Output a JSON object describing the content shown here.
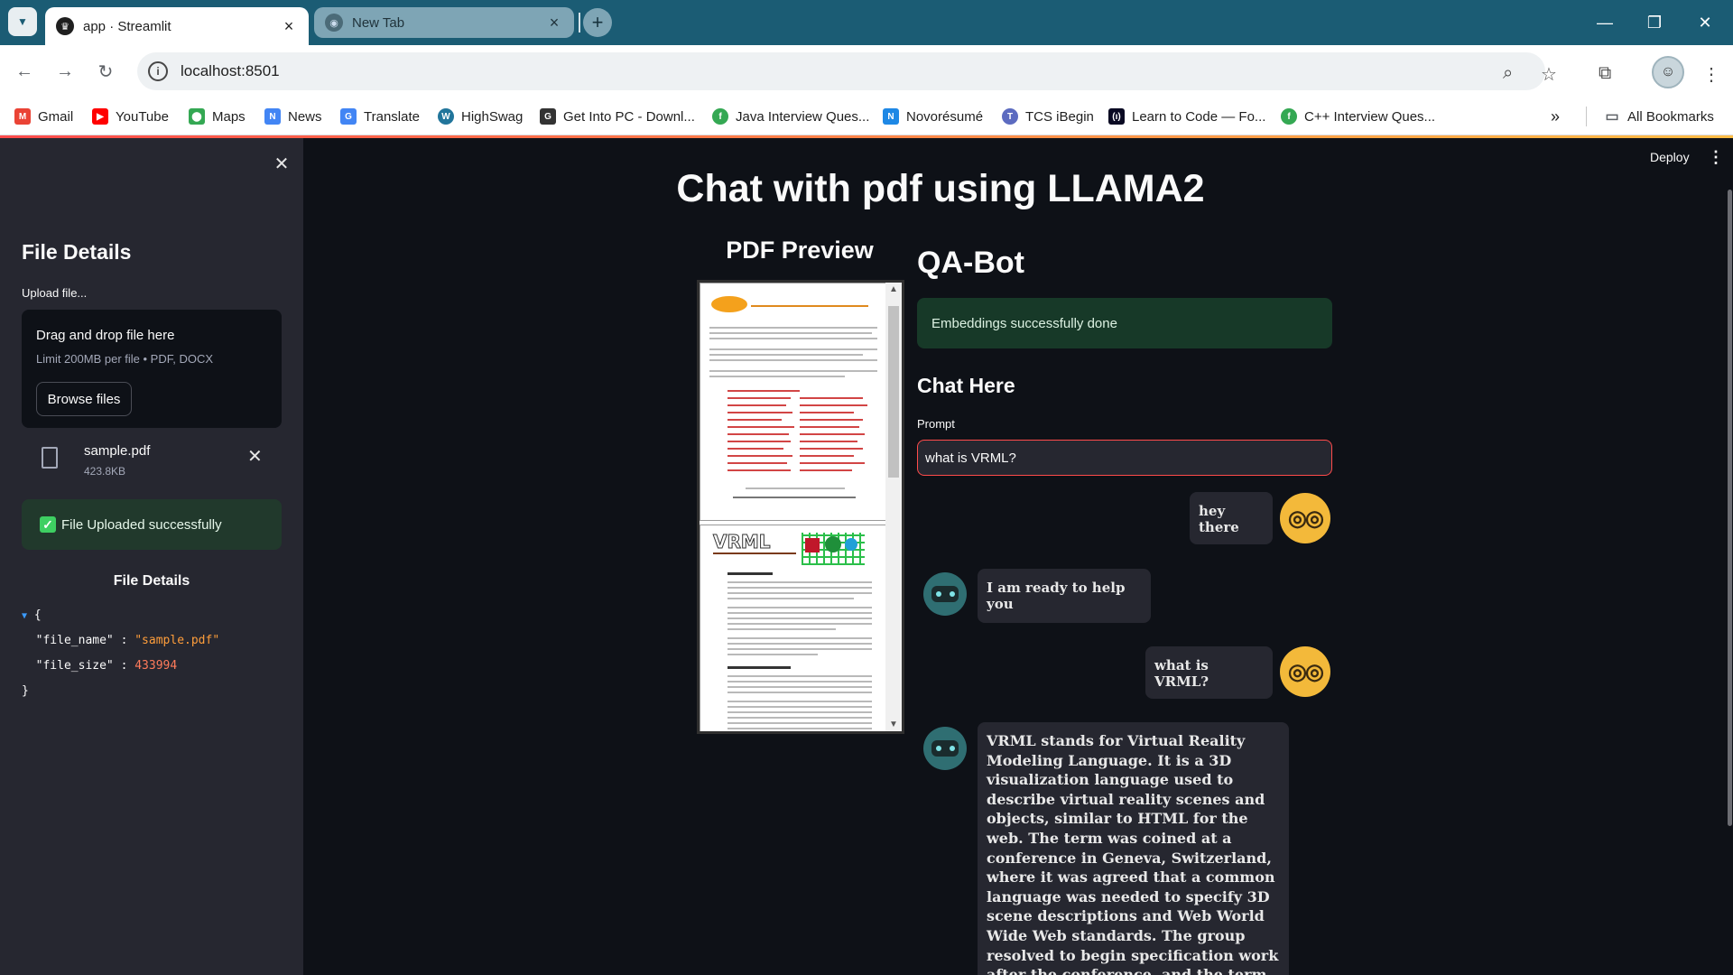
{
  "browser": {
    "tabs": [
      {
        "title": "app · Streamlit",
        "active": true
      },
      {
        "title": "New Tab",
        "active": false
      }
    ],
    "url": "localhost:8501",
    "bookmarks": [
      {
        "label": "Gmail",
        "icon": "gmail-icon",
        "color": "#ea4335"
      },
      {
        "label": "YouTube",
        "icon": "youtube-icon",
        "color": "#ff0000"
      },
      {
        "label": "Maps",
        "icon": "maps-icon",
        "color": "#34a853"
      },
      {
        "label": "News",
        "icon": "news-icon",
        "color": "#4285f4"
      },
      {
        "label": "Translate",
        "icon": "translate-icon",
        "color": "#4285f4"
      },
      {
        "label": "HighSwag",
        "icon": "wordpress-icon",
        "color": "#21759b"
      },
      {
        "label": "Get Into PC - Downl...",
        "icon": "g-icon",
        "color": "#333333"
      },
      {
        "label": "Java Interview Ques...",
        "icon": "leaf-icon",
        "color": "#34a853"
      },
      {
        "label": "Novorésumé",
        "icon": "n-icon",
        "color": "#1e88e5"
      },
      {
        "label": "TCS iBegin",
        "icon": "tcs-icon",
        "color": "#5c6bc0"
      },
      {
        "label": "Learn to Code — Fo...",
        "icon": "fcc-icon",
        "color": "#0a0a23"
      },
      {
        "label": "C++ Interview Ques...",
        "icon": "leaf-icon",
        "color": "#34a853"
      }
    ],
    "all_bookmarks": "All Bookmarks"
  },
  "sidebar": {
    "heading": "File Details",
    "upload_label": "Upload file...",
    "dropzone_title": "Drag and drop file here",
    "dropzone_limit": "Limit 200MB per file • PDF, DOCX",
    "browse_label": "Browse files",
    "file": {
      "name": "sample.pdf",
      "size": "423.8KB"
    },
    "success": "File Uploaded successfully",
    "details_heading": "File Details",
    "json": {
      "file_name_key": "\"file_name\"",
      "file_name_value": "\"sample.pdf\"",
      "file_size_key": "\"file_size\"",
      "file_size_value": "433994"
    }
  },
  "header": {
    "deploy": "Deploy"
  },
  "main": {
    "title": "Chat with pdf using LLAMA2",
    "preview_heading": "PDF Preview",
    "qa_heading": "QA-Bot",
    "embed_status": "Embeddings successfully done",
    "chat_heading": "Chat Here",
    "prompt_label": "Prompt",
    "prompt_value": "what is VRML?",
    "messages": [
      {
        "role": "user",
        "text": "hey there"
      },
      {
        "role": "assistant",
        "text": "I am ready to help you"
      },
      {
        "role": "user",
        "text": "what is VRML?"
      },
      {
        "role": "assistant",
        "text": "VRML stands for Virtual Reality Modeling Language. It is a 3D visualization language used to describe virtual reality scenes and objects, similar to HTML for the web. The term was coined at a conference in Geneva, Switzerland, where it was agreed that a common language was needed to specify 3D scene descriptions and Web World Wide Web standards. The group resolved to begin specification work after the conference, and the term \"Modeling\" was later changed to reflect the graphical nature of the language."
      }
    ]
  },
  "colors": {
    "accent": "#ff4b4b",
    "success_bg": "#173928",
    "sidebar_bg": "#262730",
    "app_bg": "#0e1117"
  }
}
